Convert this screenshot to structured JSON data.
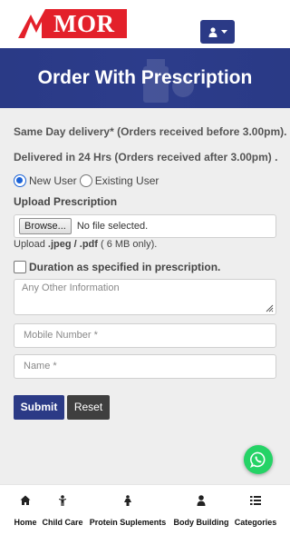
{
  "header": {
    "logo_text": "MOR",
    "brand_color": "#e3202a",
    "account_icon": "user-icon",
    "account_caret": "caret-down-icon"
  },
  "banner": {
    "title": "Order With Prescription",
    "color": "#2b3a86"
  },
  "form": {
    "delivery_note_1": "Same Day delivery* (Orders received before 3.00pm).",
    "delivery_note_2": "Delivered in 24 Hrs (Orders received after 3.00pm) .",
    "user_type": {
      "options": [
        {
          "label": "New User",
          "selected": true
        },
        {
          "label": "Existing User",
          "selected": false
        }
      ]
    },
    "upload_label": "Upload Prescription",
    "browse_label": "Browse...",
    "file_status": "No file selected.",
    "upload_hint_prefix": "Upload ",
    "upload_hint_formats": ".jpeg / .pdf",
    "upload_hint_suffix": " ( 6 MB only).",
    "duration_checkbox_label": "Duration as specified in prescription.",
    "duration_checked": false,
    "other_info_placeholder": "Any Other Information",
    "mobile_placeholder": "Mobile Number *",
    "name_placeholder": "Name *",
    "submit_label": "Submit",
    "reset_label": "Reset"
  },
  "floating": {
    "whatsapp_icon": "whatsapp-icon",
    "color": "#25d366"
  },
  "bottom_nav": {
    "items": [
      {
        "label": "Home",
        "icon": "home-icon"
      },
      {
        "label": "Child Care",
        "icon": "child-icon"
      },
      {
        "label": "Protein Suplements",
        "icon": "person-icon"
      },
      {
        "label": "Body Building",
        "icon": "user-icon"
      },
      {
        "label": "Categories",
        "icon": "list-icon"
      }
    ]
  }
}
